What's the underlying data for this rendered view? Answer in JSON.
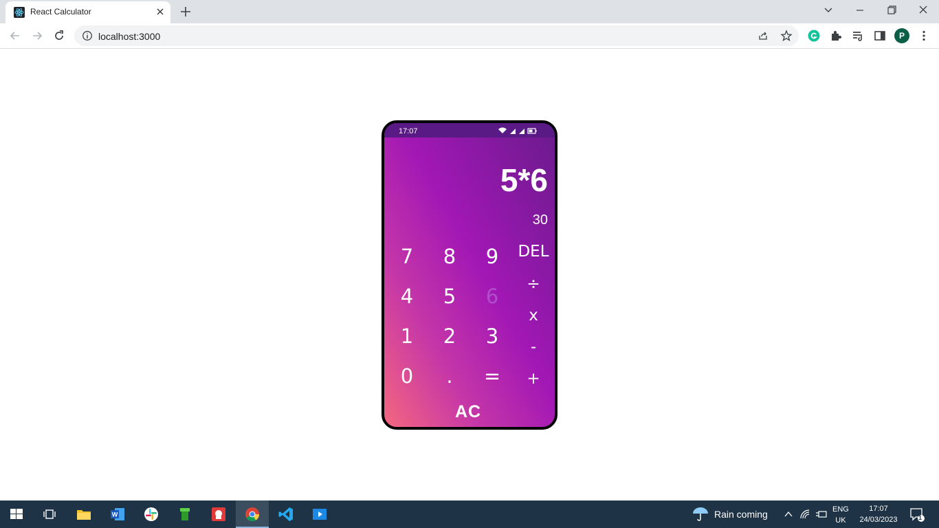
{
  "browser": {
    "tab_title": "React Calculator",
    "url": "localhost:3000",
    "profile_initial": "P"
  },
  "phone": {
    "status_time": "17:07",
    "expression": "5*6",
    "result": "30",
    "keys": [
      "7",
      "8",
      "9",
      "4",
      "5",
      "6",
      "1",
      "2",
      "3",
      "0",
      ".",
      "="
    ],
    "ops": [
      "DEL",
      "÷",
      "x",
      "-",
      "+"
    ],
    "clear": "AC"
  },
  "taskbar": {
    "weather": "Rain coming",
    "lang_top": "ENG",
    "lang_bottom": "UK",
    "time": "17:07",
    "date": "24/03/2023",
    "notifications": "1"
  },
  "colors": {
    "gradient": [
      "#f4677f",
      "#c536a8",
      "#a117b5",
      "#6a1b8c"
    ],
    "status_bar": "#5a1a85",
    "taskbar": "#1f3346"
  }
}
